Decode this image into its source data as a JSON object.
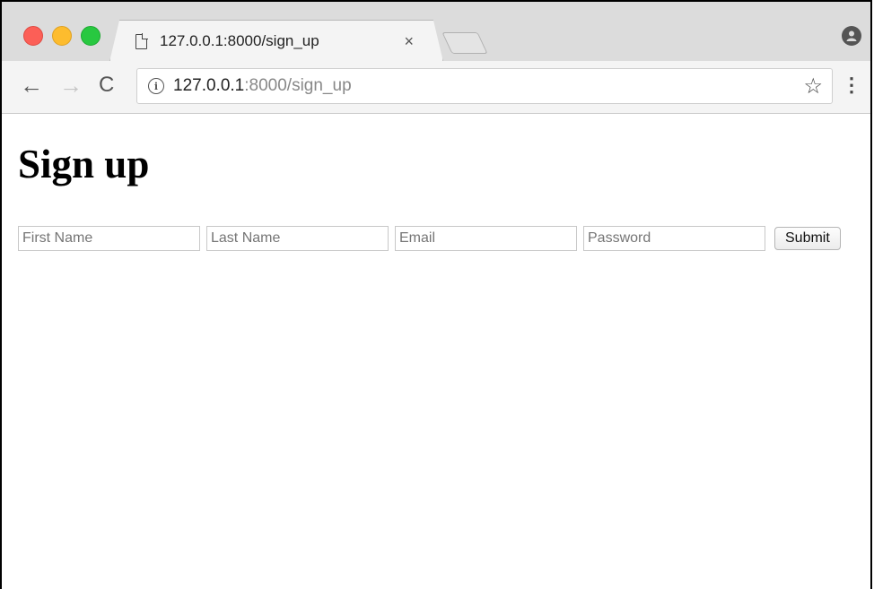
{
  "tab": {
    "title": "127.0.0.1:8000/sign_up",
    "close_label": "×"
  },
  "toolbar": {
    "back_label": "←",
    "forward_label": "→",
    "reload_label": "C",
    "url_host": "127.0.0.1",
    "url_rest": ":8000/sign_up",
    "info_label": "i",
    "star_label": "☆",
    "menu_label": "⋮"
  },
  "profile_label": "●",
  "page": {
    "heading": "Sign up",
    "form": {
      "first_name_placeholder": "First Name",
      "last_name_placeholder": "Last Name",
      "email_placeholder": "Email",
      "password_placeholder": "Password",
      "submit_label": "Submit"
    }
  },
  "colors": {
    "close": "#fc5f57",
    "minimize": "#fdbc2e",
    "zoom": "#28c840"
  },
  "icons": [
    "page-icon",
    "info-icon",
    "star-icon",
    "menu-icon",
    "profile-icon",
    "back-icon",
    "forward-icon",
    "reload-icon"
  ]
}
